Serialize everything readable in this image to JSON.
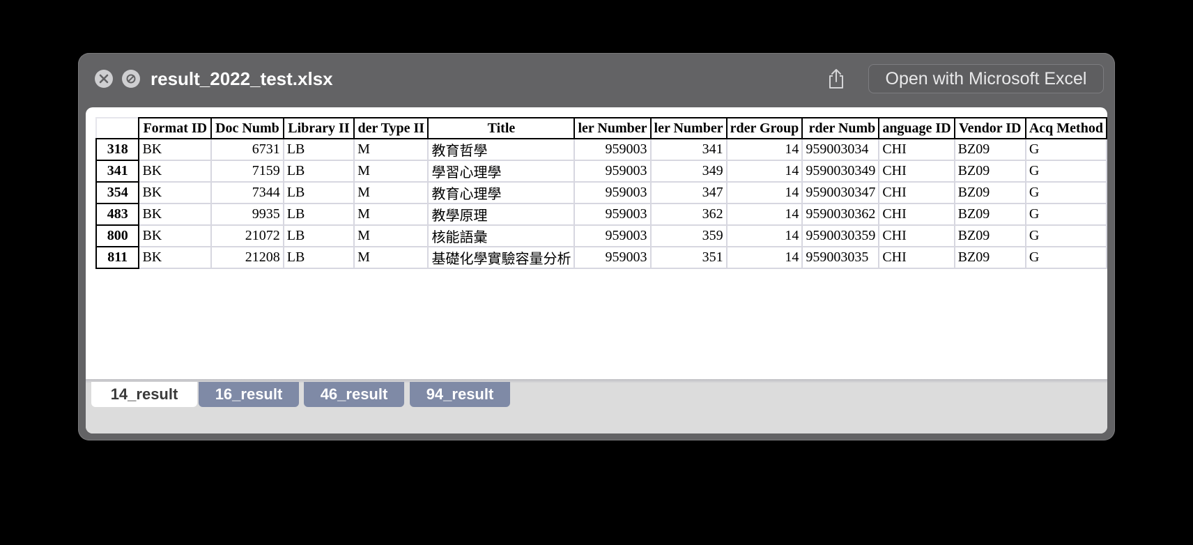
{
  "window": {
    "title": "result_2022_test.xlsx",
    "open_button": "Open with Microsoft Excel"
  },
  "icons": {
    "close": "close-icon",
    "slash": "slash-circle-icon",
    "share": "share-icon"
  },
  "table": {
    "headers": [
      "Format ID",
      "Doc Numb",
      "Library II",
      "der Type II",
      "Title",
      "ler Number",
      "ler Number",
      "rder Group",
      "rder Numb",
      "anguage ID",
      "Vendor ID",
      "Acq Method"
    ],
    "rows": [
      {
        "num": "318",
        "cells": [
          "BK",
          "6731",
          "LB",
          "M",
          "教育哲學",
          "959003",
          "341",
          "14",
          "959003034",
          "CHI",
          "BZ09",
          "G"
        ]
      },
      {
        "num": "341",
        "cells": [
          "BK",
          "7159",
          "LB",
          "M",
          "學習心理學",
          "959003",
          "349",
          "14",
          "9590030349",
          "CHI",
          "BZ09",
          "G"
        ]
      },
      {
        "num": "354",
        "cells": [
          "BK",
          "7344",
          "LB",
          "M",
          "教育心理學",
          "959003",
          "347",
          "14",
          "9590030347",
          "CHI",
          "BZ09",
          "G"
        ]
      },
      {
        "num": "483",
        "cells": [
          "BK",
          "9935",
          "LB",
          "M",
          "教學原理",
          "959003",
          "362",
          "14",
          "9590030362",
          "CHI",
          "BZ09",
          "G"
        ]
      },
      {
        "num": "800",
        "cells": [
          "BK",
          "21072",
          "LB",
          "M",
          "核能語彙",
          "959003",
          "359",
          "14",
          "9590030359",
          "CHI",
          "BZ09",
          "G"
        ]
      },
      {
        "num": "811",
        "cells": [
          "BK",
          "21208",
          "LB",
          "M",
          "基礎化學實驗容量分析",
          "959003",
          "351",
          "14",
          "959003035",
          "CHI",
          "BZ09",
          "G"
        ]
      }
    ]
  },
  "sheet_tabs": [
    {
      "label": "14_result",
      "active": true
    },
    {
      "label": "16_result",
      "active": false
    },
    {
      "label": "46_result",
      "active": false
    },
    {
      "label": "94_result",
      "active": false
    }
  ]
}
